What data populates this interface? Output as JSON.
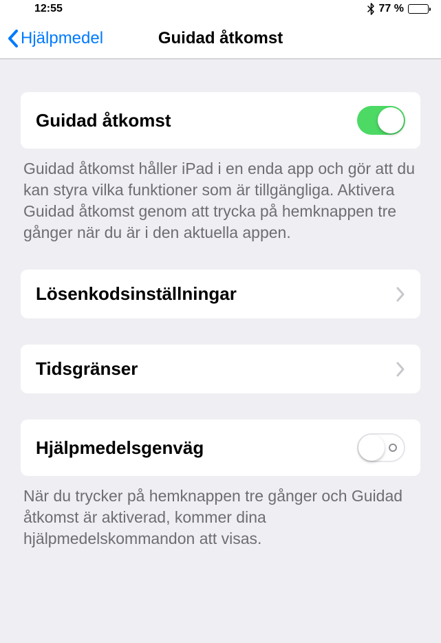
{
  "statusBar": {
    "time": "12:55",
    "batteryPercent": "77 %"
  },
  "nav": {
    "back": "Hjälpmedel",
    "title": "Guidad åtkomst"
  },
  "group1": {
    "label": "Guidad åtkomst",
    "footer": "Guidad åtkomst håller iPad i en enda app och gör att du kan styra vilka funktioner som är tillgängliga. Aktivera Guidad åtkomst genom att trycka på hemknappen tre gånger när du är i den aktuella appen."
  },
  "group2": {
    "label": "Lösenkodsinställningar"
  },
  "group3": {
    "label": "Tidsgränser"
  },
  "group4": {
    "label": "Hjälpmedelsgenväg",
    "footer": "När du trycker på hemknappen tre gånger och Guidad åtkomst är aktiverad, kommer dina hjälpmedelskommandon att visas."
  }
}
